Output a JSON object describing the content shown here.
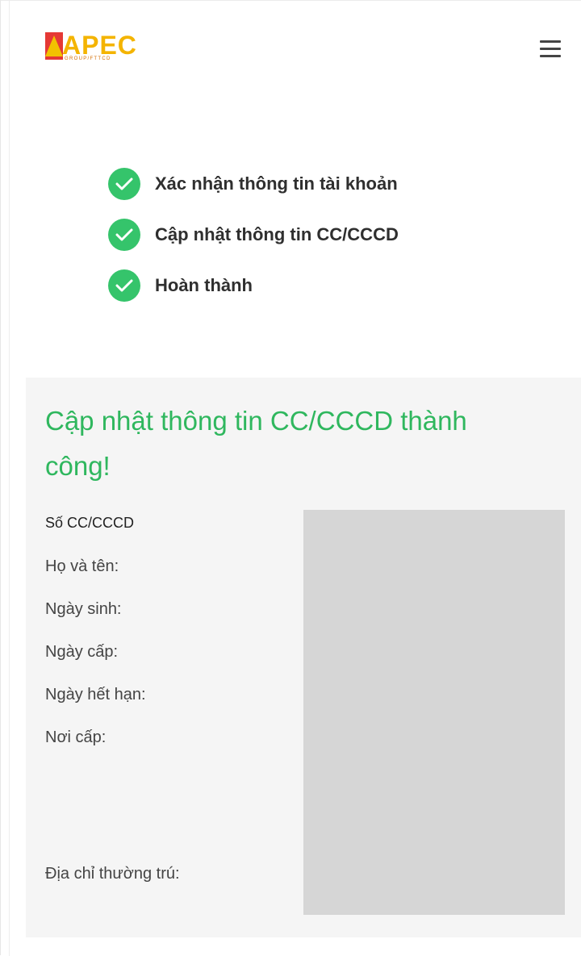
{
  "header": {
    "logo_text": "APEC",
    "logo_subtext": "GROUP/FTTCD",
    "menu_icon": "hamburger-icon"
  },
  "steps": [
    {
      "label": "Xác nhận thông tin tài khoản",
      "status": "done",
      "icon": "check-circle-icon"
    },
    {
      "label": "Cập nhật thông tin CC/CCCD",
      "status": "done",
      "icon": "check-circle-icon"
    },
    {
      "label": "Hoàn thành",
      "status": "done",
      "icon": "check-circle-icon"
    }
  ],
  "result": {
    "title": "Cập nhật thông tin CC/CCCD thành công!",
    "fields": [
      {
        "label": "Số CC/CCCD"
      },
      {
        "label": "Họ và tên:"
      },
      {
        "label": "Ngày sinh:"
      },
      {
        "label": "Ngày cấp:"
      },
      {
        "label": "Ngày hết hạn:"
      },
      {
        "label": "Nơi cấp:"
      },
      {
        "label": "Địa chỉ thường trú:"
      }
    ]
  },
  "colors": {
    "success_green": "#35c46b",
    "title_green": "#2fb75e",
    "card_bg": "#f5f5f5",
    "redacted_gray": "#d6d6d6",
    "logo_yellow": "#f4b400",
    "logo_red": "#e53935"
  }
}
